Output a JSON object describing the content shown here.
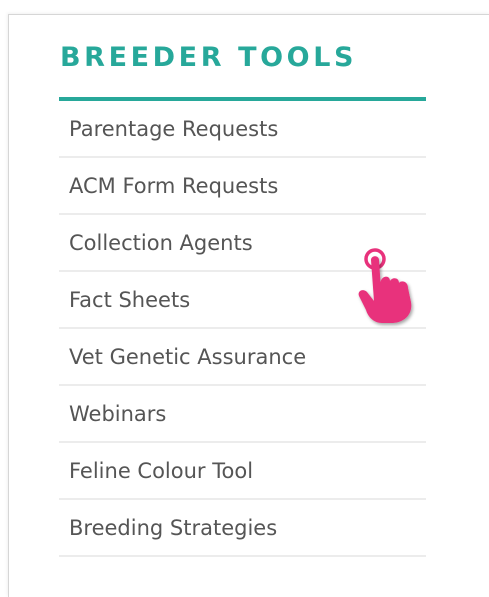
{
  "sidebar": {
    "heading": "BREEDER TOOLS",
    "accent_color": "#27a89a",
    "items": [
      {
        "label": "Parentage Requests"
      },
      {
        "label": "ACM Form Requests"
      },
      {
        "label": "Collection Agents"
      },
      {
        "label": "Fact Sheets"
      },
      {
        "label": "Vet Genetic Assurance"
      },
      {
        "label": "Webinars"
      },
      {
        "label": "Feline Colour Tool"
      },
      {
        "label": "Breeding Strategies"
      }
    ]
  },
  "cursor": {
    "icon": "pointing-hand-icon",
    "color": "#e8327c",
    "hovered_item": "Collection Agents"
  }
}
